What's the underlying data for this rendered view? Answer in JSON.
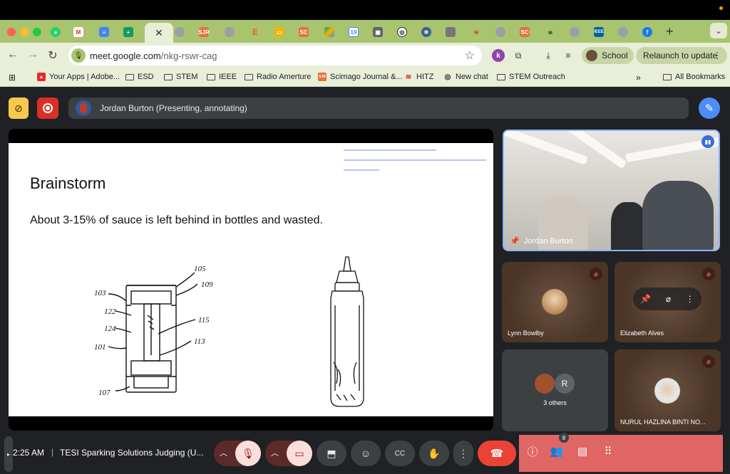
{
  "browser": {
    "url_host": "meet.google.com",
    "url_path": "/nkg-rswr-cag",
    "profile_label": "School",
    "relaunch_label": "Relaunch to update",
    "bookmarks": [
      {
        "label": "Your Apps | Adobe..."
      },
      {
        "label": "ESD"
      },
      {
        "label": "STEM"
      },
      {
        "label": "IEEE"
      },
      {
        "label": "Radio Amerture"
      },
      {
        "label": "Scimago Journal &..."
      },
      {
        "label": "HITZ"
      },
      {
        "label": "New chat"
      },
      {
        "label": "STEM Outreach"
      },
      {
        "label": "All Bookmarks"
      }
    ],
    "tab_favicon_labels": {
      "sjr": "SJR",
      "etsy": "E",
      "sc": "SC",
      "cal": "19",
      "ieee": "IEEE"
    },
    "brand_colors": {
      "frame": "#a8c46f",
      "toolbar": "#e9eed9"
    }
  },
  "meet": {
    "presenting_text": "Jordan Burton (Presenting, annotating)",
    "slide": {
      "title": "Brainstorm",
      "body": "About 3-15% of sauce is left behind in bottles and wasted.",
      "patent_labels": [
        "105",
        "103",
        "109",
        "122",
        "124",
        "115",
        "101",
        "113",
        "107"
      ]
    },
    "participants": {
      "main": {
        "name": "Jordan Burton"
      },
      "tiles": [
        {
          "name": "Lynn Bowlby",
          "muted": true
        },
        {
          "name": "Elizabeth Alves",
          "muted": true
        },
        {
          "name": "3 others",
          "avatar_letter": "R"
        },
        {
          "name": "NURUL HAZLINA BINTI NO...",
          "muted": true
        }
      ]
    },
    "controls": {
      "time": "2:25 AM",
      "separator": "|",
      "meeting_title": "TESI Sparking Solutions Judging (U...",
      "people_count": "8"
    },
    "colors": {
      "hangup": "#ea4335",
      "panel": "#e06666",
      "active_border": "#8ab4f8"
    }
  }
}
